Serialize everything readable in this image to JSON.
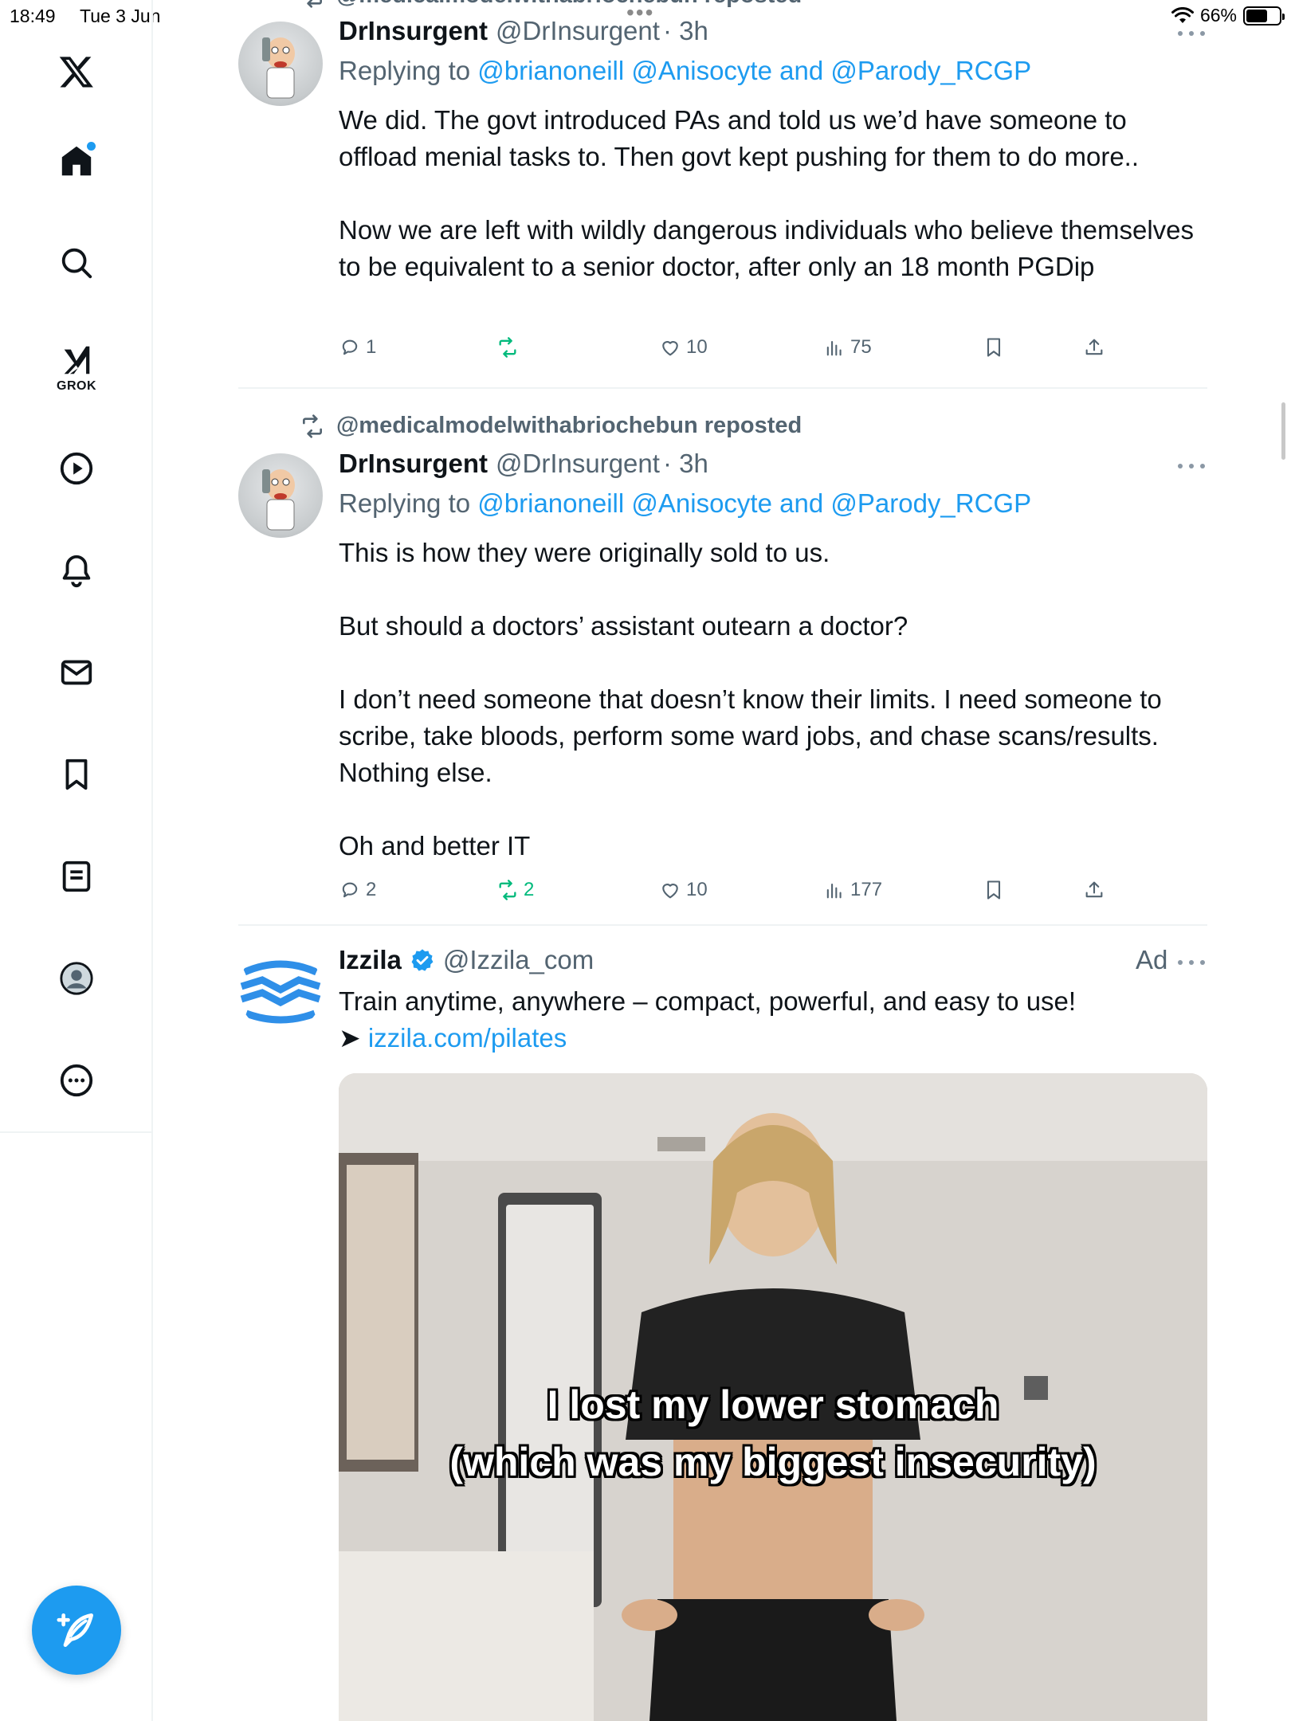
{
  "status_bar": {
    "time": "18:49",
    "date": "Tue 3 Jun",
    "battery": "66%",
    "battery_level": 0.66
  },
  "sidebar": {
    "logo": "x-logo-icon",
    "items": [
      {
        "name": "home-icon",
        "label": "Home",
        "has_notification_dot": true
      },
      {
        "name": "search-icon",
        "label": "Explore"
      },
      {
        "name": "grok-icon",
        "label": "GROK"
      },
      {
        "name": "play-icon",
        "label": "Video"
      },
      {
        "name": "bell-icon",
        "label": "Notifications"
      },
      {
        "name": "mail-icon",
        "label": "Messages"
      },
      {
        "name": "bookmark-icon",
        "label": "Bookmarks"
      },
      {
        "name": "notes-icon",
        "label": "Articles"
      },
      {
        "name": "profile-icon",
        "label": "Profile"
      },
      {
        "name": "more-icon",
        "label": "More"
      }
    ],
    "grok_label": "GROK",
    "compose": "compose-icon"
  },
  "feed": {
    "top_partial_repost": "@medicalmodelwithabriochebun reposted",
    "tweets": [
      {
        "name": "DrInsurgent",
        "handle": "@DrInsurgent",
        "time": "· 3h",
        "reply_prefix": "Replying to",
        "reply_users": "@brianoneill @Anisocyte",
        "reply_and": "and",
        "reply_last": "@Parody_RCGP",
        "text": [
          "We did. The govt introduced PAs and told us we’d have someone to offload menial tasks to. Then govt kept pushing for them to do more..",
          "",
          "Now we are left with wildly dangerous individuals who believe themselves to be equivalent to a senior doctor, after only an 18 month PGDip"
        ],
        "stats": {
          "replies": "1",
          "reposts": "",
          "likes": "10",
          "views": "75"
        }
      },
      {
        "repost_label": "@medicalmodelwithabriochebun reposted",
        "name": "DrInsurgent",
        "handle": "@DrInsurgent",
        "time": "· 3h",
        "reply_prefix": "Replying to",
        "reply_users": "@brianoneill @Anisocyte",
        "reply_and": "and",
        "reply_last": "@Parody_RCGP",
        "text": [
          "This is how they were originally sold to us.",
          "",
          "But should a doctors’ assistant outearn a doctor?",
          "",
          "I don’t need someone that doesn’t know their limits. I need someone to scribe, take bloods, perform some ward jobs, and chase scans/results. Nothing else.",
          "",
          "Oh and better IT"
        ],
        "stats": {
          "replies": "2",
          "reposts": "2",
          "likes": "10",
          "views": "177"
        }
      },
      {
        "name": "Izzila",
        "handle": "@Izzila_com",
        "ad_label": "Ad",
        "text": "Train anytime, anywhere – compact, powerful, and easy to use!",
        "link_arrow": "➤",
        "link": "izzila.com/pilates",
        "media_caption_1": "I lost my lower stomach",
        "media_caption_2": "(which was my biggest insecurity)"
      }
    ]
  },
  "colors": {
    "accent": "#1d9bf0",
    "repost_green": "#00ba7c",
    "muted": "#536471",
    "text": "#0f1419"
  }
}
